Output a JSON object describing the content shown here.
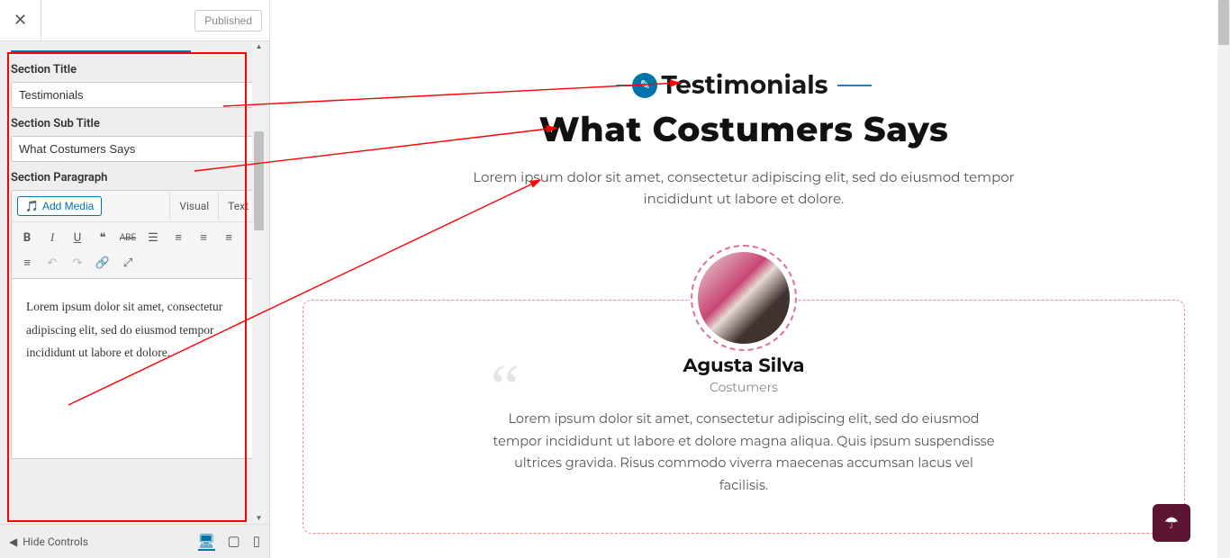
{
  "header": {
    "publish_label": "Published"
  },
  "panel": {
    "section_title_label": "Section Title",
    "section_title_value": "Testimonials",
    "section_subtitle_label": "Section Sub Title",
    "section_subtitle_value": "What Costumers Says",
    "section_para_label": "Section Paragraph",
    "add_media_label": "Add Media",
    "tabs": {
      "visual": "Visual",
      "text": "Text"
    },
    "editor_content": "Lorem ipsum dolor sit amet, consectetur adipiscing elit, sed do eiusmod tempor incididunt ut labore et dolore."
  },
  "footer": {
    "hide_controls": "Hide Controls"
  },
  "preview": {
    "section_title": "Testimonials",
    "section_subtitle": "What Costumers Says",
    "section_para": "Lorem ipsum dolor sit amet, consectetur adipiscing elit, sed do eiusmod tempor incididunt ut labore et dolore.",
    "person_name": "Agusta Silva",
    "person_role": "Costumers",
    "testimonial_text": "Lorem ipsum dolor sit amet, consectetur adipiscing elit, sed do eiusmod tempor incididunt ut labore et dolore magna aliqua. Quis ipsum suspendisse ultrices gravida. Risus commodo viverra maecenas accumsan lacus vel facilisis."
  },
  "colors": {
    "accent": "#0073aa",
    "dashed": "#f28a8a",
    "float_btn": "#5c1633"
  }
}
